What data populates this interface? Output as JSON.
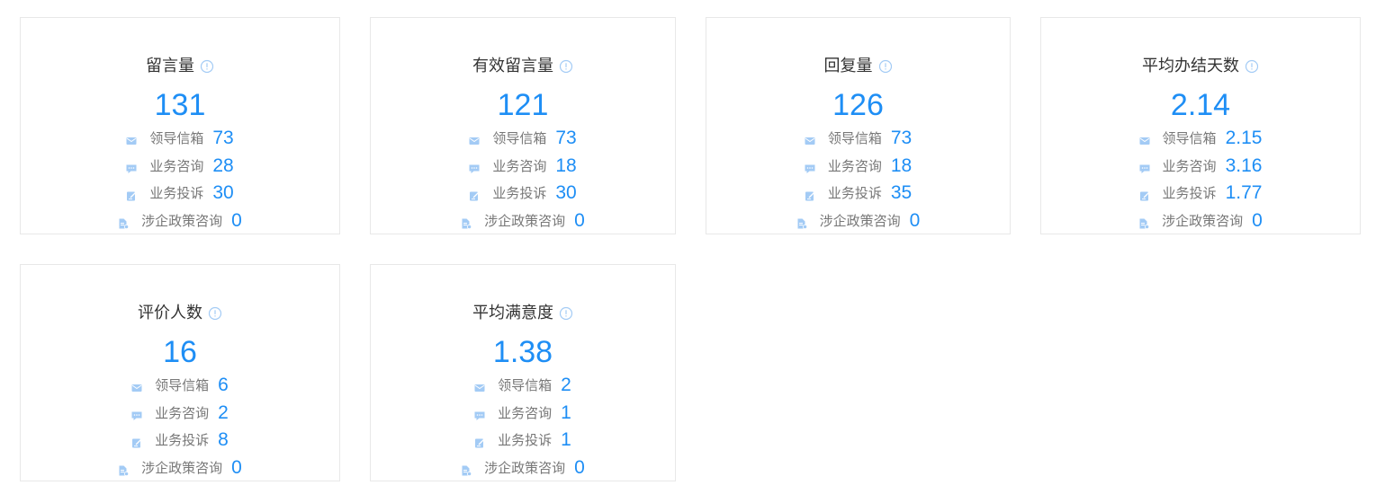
{
  "cards": [
    {
      "title": "留言量",
      "value": "131",
      "rows": [
        {
          "icon": "mail-icon",
          "label": "领导信箱",
          "value": "73"
        },
        {
          "icon": "chat-icon",
          "label": "业务咨询",
          "value": "28"
        },
        {
          "icon": "edit-icon",
          "label": "业务投诉",
          "value": "30"
        },
        {
          "icon": "document-icon",
          "label": "涉企政策咨询",
          "value": "0"
        }
      ]
    },
    {
      "title": "有效留言量",
      "value": "121",
      "rows": [
        {
          "icon": "mail-icon",
          "label": "领导信箱",
          "value": "73"
        },
        {
          "icon": "chat-icon",
          "label": "业务咨询",
          "value": "18"
        },
        {
          "icon": "edit-icon",
          "label": "业务投诉",
          "value": "30"
        },
        {
          "icon": "document-icon",
          "label": "涉企政策咨询",
          "value": "0"
        }
      ]
    },
    {
      "title": "回复量",
      "value": "126",
      "rows": [
        {
          "icon": "mail-icon",
          "label": "领导信箱",
          "value": "73"
        },
        {
          "icon": "chat-icon",
          "label": "业务咨询",
          "value": "18"
        },
        {
          "icon": "edit-icon",
          "label": "业务投诉",
          "value": "35"
        },
        {
          "icon": "document-icon",
          "label": "涉企政策咨询",
          "value": "0"
        }
      ]
    },
    {
      "title": "平均办结天数",
      "value": "2.14",
      "rows": [
        {
          "icon": "mail-icon",
          "label": "领导信箱",
          "value": "2.15"
        },
        {
          "icon": "chat-icon",
          "label": "业务咨询",
          "value": "3.16"
        },
        {
          "icon": "edit-icon",
          "label": "业务投诉",
          "value": "1.77"
        },
        {
          "icon": "document-icon",
          "label": "涉企政策咨询",
          "value": "0"
        }
      ]
    },
    {
      "title": "评价人数",
      "value": "16",
      "rows": [
        {
          "icon": "mail-icon",
          "label": "领导信箱",
          "value": "6"
        },
        {
          "icon": "chat-icon",
          "label": "业务咨询",
          "value": "2"
        },
        {
          "icon": "edit-icon",
          "label": "业务投诉",
          "value": "8"
        },
        {
          "icon": "document-icon",
          "label": "涉企政策咨询",
          "value": "0"
        }
      ]
    },
    {
      "title": "平均满意度",
      "value": "1.38",
      "rows": [
        {
          "icon": "mail-icon",
          "label": "领导信箱",
          "value": "2"
        },
        {
          "icon": "chat-icon",
          "label": "业务咨询",
          "value": "1"
        },
        {
          "icon": "edit-icon",
          "label": "业务投诉",
          "value": "1"
        },
        {
          "icon": "document-icon",
          "label": "涉企政策咨询",
          "value": "0"
        }
      ]
    }
  ],
  "colors": {
    "accent": "#1e8ef5",
    "icon": "#a3cbf5",
    "border": "#e8e8e8",
    "title": "#333333",
    "label": "#777777"
  }
}
